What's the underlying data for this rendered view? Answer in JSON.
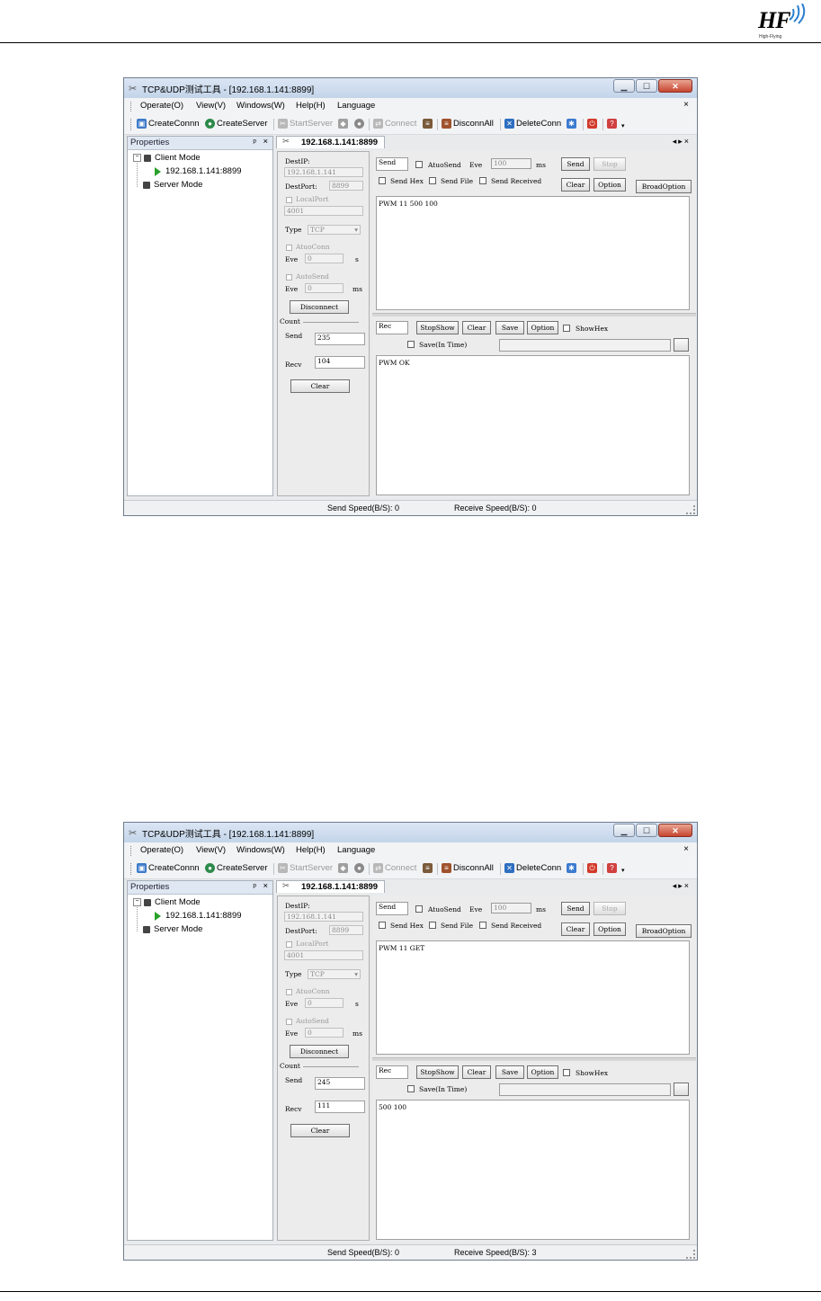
{
  "page": {
    "logo": {
      "text": "HF",
      "sub": "High-Flying"
    }
  },
  "windows": [
    {
      "title": "TCP&UDP测试工具 - [192.168.1.141:8899]",
      "menu": [
        "Operate(O)",
        "View(V)",
        "Windows(W)",
        "Help(H)",
        "Language"
      ],
      "toolbar": {
        "create_conn": "CreateConnn",
        "create_server": "CreateServer",
        "start_server": "StartServer",
        "connect": "Connect",
        "disconn_all": "DisconnAll",
        "delete_conn": "DeleteConn"
      },
      "properties": {
        "title": "Properties",
        "client_mode": "Client Mode",
        "client_item": "192.168.1.141:8899",
        "server_mode": "Server Mode"
      },
      "tab_label": "192.168.1.141:8899",
      "config": {
        "dest_ip_label": "DestIP:",
        "dest_ip_value": "192.168.1.141",
        "dest_port_label": "DestPort:",
        "dest_port_value": "8899",
        "local_port_label": "LocalPort",
        "local_port_value": "4001",
        "type_label": "Type",
        "type_value": "TCP",
        "auto_conn_label": "AtuoConn",
        "eve_label_1": "Eve",
        "eve_value_1": "0",
        "unit_s": "s",
        "auto_send_label": "AutoSend",
        "eve_label_2": "Eve",
        "eve_value_2": "0",
        "unit_ms": "ms",
        "disconnect_btn": "Disconnect",
        "count_label": "Count",
        "send_label": "Send",
        "send_count": "235",
        "recv_label": "Recv",
        "recv_count": "104",
        "clear_btn": "Clear"
      },
      "send_panel": {
        "send_field": "Send",
        "auto_send": "AtuoSend",
        "eve": "Eve",
        "eve_value": "100",
        "unit": "ms",
        "send_btn": "Send",
        "stop_btn": "Stop",
        "send_hex": "Send Hex",
        "send_file": "Send File",
        "send_received": "Send Received",
        "clear_btn": "Clear",
        "option_btn": "Option",
        "broad_option_btn": "BroadOption",
        "content": "PWM 11 500 100"
      },
      "recv_panel": {
        "rec_field": "Rec",
        "stopshow_btn": "StopShow",
        "clear_btn": "Clear",
        "save_btn": "Save",
        "option_btn": "Option",
        "show_hex": "ShowHex",
        "save_in_time": "Save(In Time)",
        "content": "PWM OK"
      },
      "status": {
        "send_speed": "Send Speed(B/S): 0",
        "recv_speed": "Receive Speed(B/S): 0"
      }
    },
    {
      "title": "TCP&UDP测试工具 - [192.168.1.141:8899]",
      "menu": [
        "Operate(O)",
        "View(V)",
        "Windows(W)",
        "Help(H)",
        "Language"
      ],
      "toolbar": {
        "create_conn": "CreateConnn",
        "create_server": "CreateServer",
        "start_server": "StartServer",
        "connect": "Connect",
        "disconn_all": "DisconnAll",
        "delete_conn": "DeleteConn"
      },
      "properties": {
        "title": "Properties",
        "client_mode": "Client Mode",
        "client_item": "192.168.1.141:8899",
        "server_mode": "Server Mode"
      },
      "tab_label": "192.168.1.141:8899",
      "config": {
        "dest_ip_label": "DestIP:",
        "dest_ip_value": "192.168.1.141",
        "dest_port_label": "DestPort:",
        "dest_port_value": "8899",
        "local_port_label": "LocalPort",
        "local_port_value": "4001",
        "type_label": "Type",
        "type_value": "TCP",
        "auto_conn_label": "AtuoConn",
        "eve_label_1": "Eve",
        "eve_value_1": "0",
        "unit_s": "s",
        "auto_send_label": "AutoSend",
        "eve_label_2": "Eve",
        "eve_value_2": "0",
        "unit_ms": "ms",
        "disconnect_btn": "Disconnect",
        "count_label": "Count",
        "send_label": "Send",
        "send_count": "245",
        "recv_label": "Recv",
        "recv_count": "111",
        "clear_btn": "Clear"
      },
      "send_panel": {
        "send_field": "Send",
        "auto_send": "AtuoSend",
        "eve": "Eve",
        "eve_value": "100",
        "unit": "ms",
        "send_btn": "Send",
        "stop_btn": "Stop",
        "send_hex": "Send Hex",
        "send_file": "Send File",
        "send_received": "Send Received",
        "clear_btn": "Clear",
        "option_btn": "Option",
        "broad_option_btn": "BroadOption",
        "content": "PWM 11 GET"
      },
      "recv_panel": {
        "rec_field": "Rec",
        "stopshow_btn": "StopShow",
        "clear_btn": "Clear",
        "save_btn": "Save",
        "option_btn": "Option",
        "show_hex": "ShowHex",
        "save_in_time": "Save(In Time)",
        "content": "500 100"
      },
      "status": {
        "send_speed": "Send Speed(B/S): 0",
        "recv_speed": "Receive Speed(B/S): 3"
      }
    }
  ]
}
